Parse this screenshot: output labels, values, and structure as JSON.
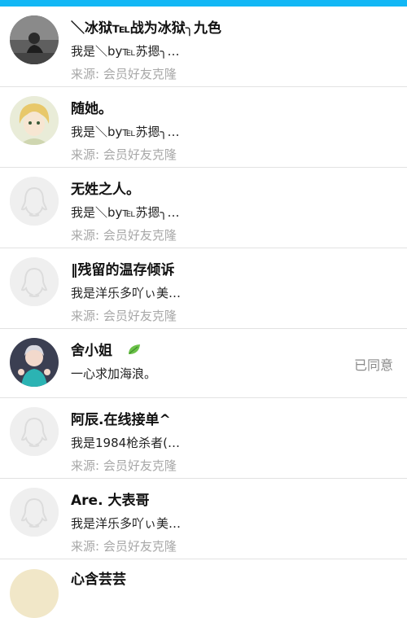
{
  "rows": [
    {
      "name": "＼冰狱℡战为冰狱╮九色",
      "message": "我是＼by℡苏摁╮…",
      "source": "来源: 会员好友克隆",
      "avatar": "photo-dark"
    },
    {
      "name": "随她。",
      "message": "我是＼by℡苏摁╮…",
      "source": "来源: 会员好友克隆",
      "avatar": "photo-anime"
    },
    {
      "name": "无姓之人。",
      "message": "我是＼by℡苏摁╮…",
      "source": "来源: 会员好友克隆",
      "avatar": "default"
    },
    {
      "name": "‖残留的温存倾诉",
      "message": "我是洋乐多吖ぃ美…",
      "source": "来源: 会员好友克隆",
      "avatar": "default"
    },
    {
      "name": "舍小姐",
      "message": "一心求加海浪。",
      "status": "已同意",
      "avatar": "photo-person"
    },
    {
      "name": "阿辰.在线接单^",
      "message": "我是1984枪杀者(…",
      "source": "来源: 会员好友克隆",
      "avatar": "default"
    },
    {
      "name": "Are. 大表哥",
      "message": "我是洋乐多吖ぃ美…",
      "source": "来源: 会员好友克隆",
      "avatar": "default"
    }
  ],
  "partial_row": {
    "name": "心含芸芸"
  },
  "colors": {
    "accent": "#12b7f5",
    "source_text": "#a8a8a8",
    "divider": "#e2e2e2"
  }
}
